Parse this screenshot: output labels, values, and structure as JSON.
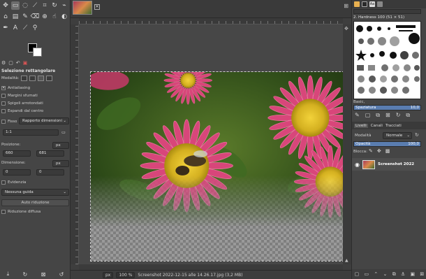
{
  "tool_options": {
    "title": "Selezione rettangolare",
    "mode_label": "Modalità:",
    "antialiasing": "Antialiasing",
    "feather": "Margini sfumati",
    "rounded": "Spigoli arrotondati",
    "expand_center": "Espandi dal centro",
    "fixed": "Fisso",
    "fixed_value": "Rapporto dimensioni",
    "ratio": "1:1",
    "position_label": "Posizione:",
    "pos_x": "660",
    "pos_y": "681",
    "unit": "px",
    "size_label": "Dimensione:",
    "size_w": "0",
    "size_h": "0",
    "highlight": "Evidenzia",
    "guides": "Nessuna guida",
    "auto_shrink": "Auto riduzione",
    "shrink_merged": "Riduzione diffusa"
  },
  "statusbar": {
    "unit": "px",
    "zoom": "100 %",
    "filename": "Screenshot 2022-12-15 alle 14.26.17.jpg (3,2 MB)"
  },
  "brushes": {
    "name": "2. Hardness 100 (51 × 51)",
    "filter": "Basic,",
    "spacing_label": "Spaziatura",
    "spacing_value": "10,0"
  },
  "layers": {
    "tabs": [
      "Livelli",
      "Canali",
      "Tracciati"
    ],
    "mode_label": "Modalità",
    "mode_value": "Normale",
    "opacity_label": "Opacità",
    "opacity_value": "100,0",
    "lock_label": "Blocca:",
    "layer_name": "Screenshot 2022"
  }
}
